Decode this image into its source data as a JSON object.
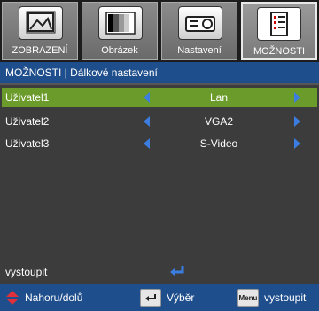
{
  "tabs": [
    {
      "label": "ZOBRAZENÍ",
      "icon": "display-icon"
    },
    {
      "label": "Obrázek",
      "icon": "image-icon"
    },
    {
      "label": "Nastavení",
      "icon": "projector-icon"
    },
    {
      "label": "MOŽNOSTI",
      "icon": "options-icon",
      "active": true
    }
  ],
  "breadcrumb": "MOŽNOSTI | Dálkové nastavení",
  "rows": [
    {
      "label": "Uživatel1",
      "value": "Lan",
      "selected": true
    },
    {
      "label": "Uživatel2",
      "value": "VGA2"
    },
    {
      "label": "Uživatel3",
      "value": "S-Video"
    }
  ],
  "exit_label": "vystoupit",
  "footer": {
    "nav_label": "Nahoru/dolů",
    "select_label": "Výběr",
    "menu_key": "Menu",
    "exit_label": "vystoupit"
  },
  "colors": {
    "accent_blue": "#1f4e8c",
    "selection_green": "#6b9b2a",
    "arrow_blue": "#3b7de0"
  }
}
